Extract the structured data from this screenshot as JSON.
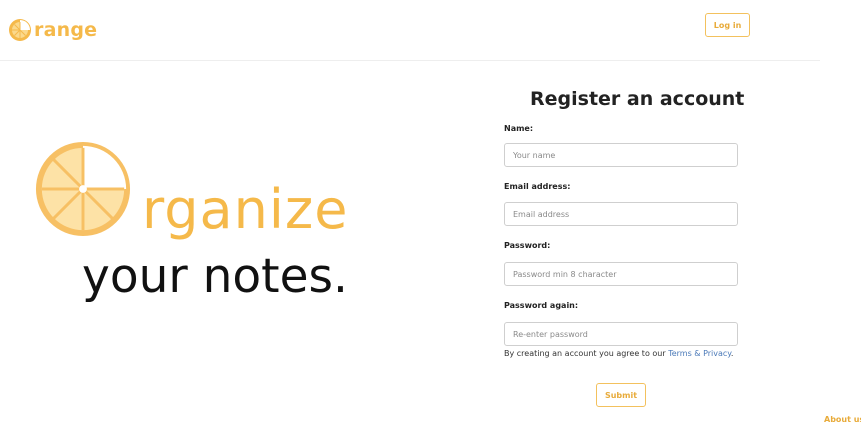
{
  "header": {
    "brand": "range",
    "login_label": "Log in"
  },
  "hero": {
    "line1": "rganize",
    "line2": "your notes."
  },
  "form": {
    "title": "Register an account",
    "fields": [
      {
        "label": "Name:",
        "placeholder": "Your name"
      },
      {
        "label": "Email address:",
        "placeholder": "Email address"
      },
      {
        "label": "Password:",
        "placeholder": "Password min 8 character"
      },
      {
        "label": "Password again:",
        "placeholder": "Re-enter password"
      }
    ],
    "terms_text": "By creating an account you agree to our ",
    "terms_link": "Terms & Privacy",
    "terms_end": ".",
    "submit_label": "Submit"
  },
  "footer": {
    "about_label": "About us"
  },
  "colors": {
    "accent": "#f5b94a",
    "link": "#4a79b8"
  },
  "icons": {
    "brand": "orange-slice-icon",
    "hero": "orange-slice-icon"
  }
}
